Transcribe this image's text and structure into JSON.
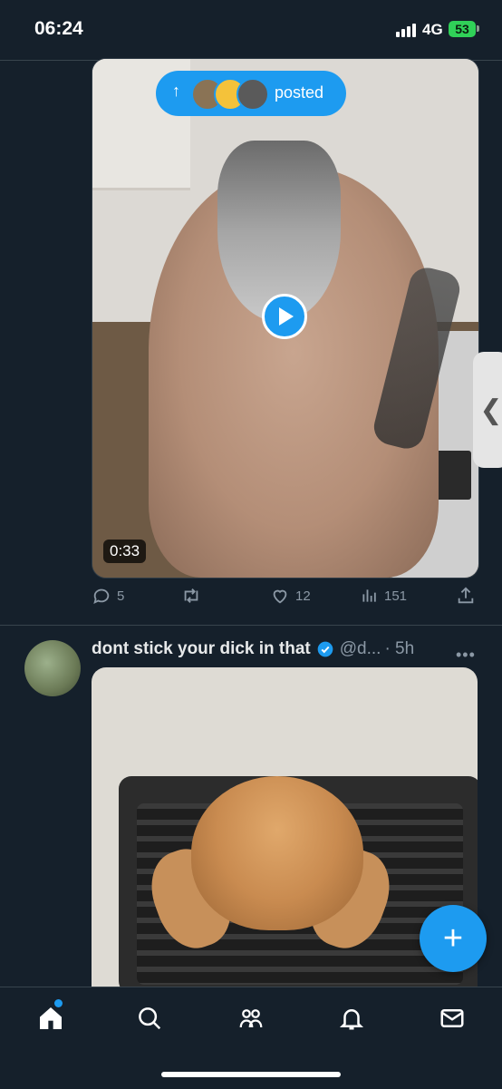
{
  "status_bar": {
    "time": "06:24",
    "network": "4G",
    "battery": "53"
  },
  "tweet1": {
    "posted_label": "posted",
    "video_duration": "0:33",
    "actions": {
      "replies": "5",
      "retweets": "",
      "likes": "12",
      "views": "151"
    }
  },
  "tweet2": {
    "name": "dont stick your dick in that",
    "handle": "@d...",
    "time": "· 5h"
  },
  "fab": {
    "label": "+"
  },
  "side_handle": {
    "label": "❮"
  },
  "colors": {
    "accent": "#1d9bf0",
    "background": "#15202b",
    "muted": "#8b98a5"
  }
}
